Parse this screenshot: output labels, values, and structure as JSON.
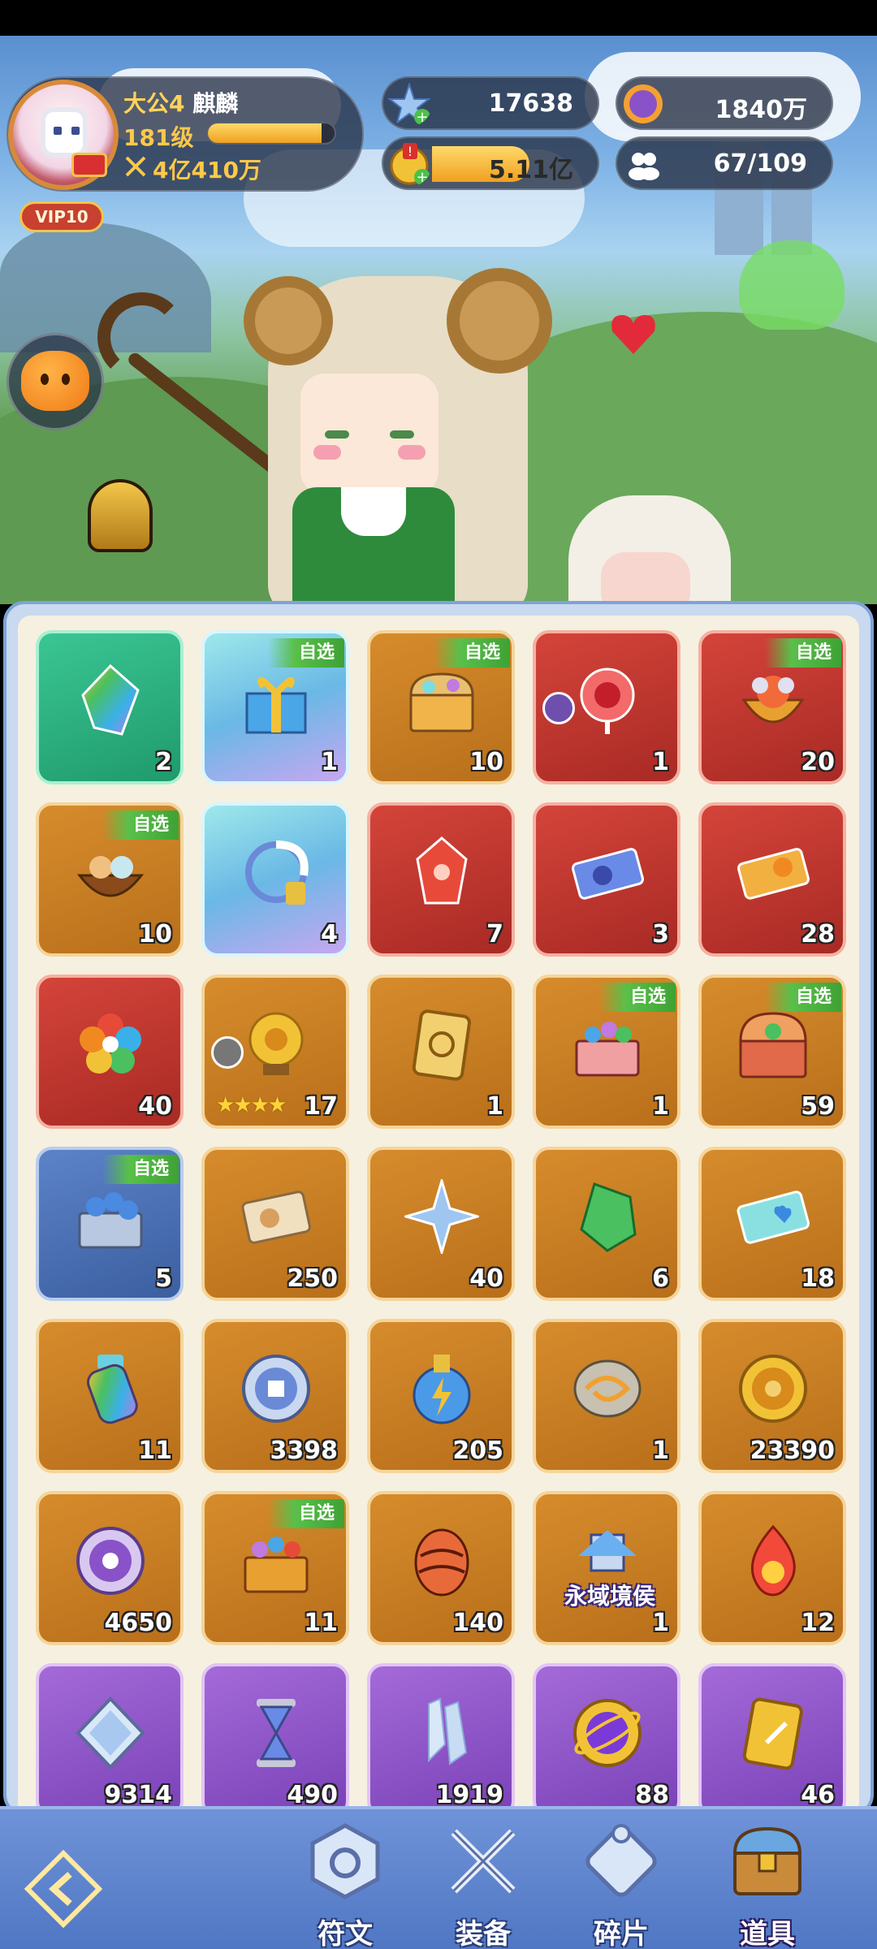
{
  "player": {
    "title": "大公4",
    "name": "麒麟",
    "level": "181级",
    "exp_fraction": 0.9,
    "power": "4亿410万",
    "vip": "VIP10"
  },
  "resources": [
    {
      "name": "star-gem",
      "value": "17638"
    },
    {
      "name": "purple-coin",
      "value": "1840万"
    },
    {
      "name": "gold-coin",
      "value": "5.11亿",
      "bar_fraction": 0.6
    },
    {
      "name": "friends",
      "value": "67/109"
    }
  ],
  "inventory": [
    {
      "icon": "rainbow-crystal-icon",
      "count": "2",
      "color": "green",
      "tag": ""
    },
    {
      "icon": "gift-box-icon",
      "count": "1",
      "color": "cyan",
      "tag": "自选"
    },
    {
      "icon": "treasure-chest-icon",
      "count": "10",
      "color": "orange",
      "tag": "自选"
    },
    {
      "icon": "crystal-ball-icon",
      "count": "1",
      "color": "red",
      "tag": ""
    },
    {
      "icon": "fire-egg-bowl-icon",
      "count": "20",
      "color": "red",
      "tag": "自选"
    },
    {
      "icon": "pet-nest-icon",
      "count": "10",
      "color": "orange",
      "tag": "自选"
    },
    {
      "icon": "wing-frame-icon",
      "count": "4",
      "color": "cyan",
      "tag": ""
    },
    {
      "icon": "red-crystal-icon",
      "count": "7",
      "color": "red",
      "tag": ""
    },
    {
      "icon": "blue-ticket-icon",
      "count": "3",
      "color": "red",
      "tag": ""
    },
    {
      "icon": "gold-ticket-icon",
      "count": "28",
      "color": "red",
      "tag": ""
    },
    {
      "icon": "rainbow-flower-icon",
      "count": "40",
      "color": "red",
      "tag": ""
    },
    {
      "icon": "gold-orb-icon",
      "count": "17",
      "color": "orange",
      "tag": "",
      "stars": "★★★★"
    },
    {
      "icon": "gold-card-icon",
      "count": "1",
      "color": "orange",
      "tag": ""
    },
    {
      "icon": "gem-chest-icon",
      "count": "1",
      "color": "orange",
      "tag": "自选"
    },
    {
      "icon": "big-chest-icon",
      "count": "59",
      "color": "orange",
      "tag": "自选"
    },
    {
      "icon": "silver-chest-icon",
      "count": "5",
      "color": "blue",
      "tag": "自选"
    },
    {
      "icon": "paper-ticket-icon",
      "count": "250",
      "color": "orange",
      "tag": ""
    },
    {
      "icon": "blue-star-crystal-icon",
      "count": "40",
      "color": "orange",
      "tag": ""
    },
    {
      "icon": "green-crystal-icon",
      "count": "6",
      "color": "orange",
      "tag": ""
    },
    {
      "icon": "heart-ticket-icon",
      "count": "18",
      "color": "orange",
      "tag": ""
    },
    {
      "icon": "rainbow-potion-icon",
      "count": "11",
      "color": "orange",
      "tag": ""
    },
    {
      "icon": "silver-coin-icon",
      "count": "3398",
      "color": "orange",
      "tag": ""
    },
    {
      "icon": "lightning-potion-icon",
      "count": "205",
      "color": "orange",
      "tag": ""
    },
    {
      "icon": "swirl-stone-icon",
      "count": "1",
      "color": "orange",
      "tag": ""
    },
    {
      "icon": "gold-coin-icon",
      "count": "23390",
      "color": "orange",
      "tag": ""
    },
    {
      "icon": "purple-coin-icon",
      "count": "4650",
      "color": "orange",
      "tag": ""
    },
    {
      "icon": "gem-basket-icon",
      "count": "11",
      "color": "orange",
      "tag": "自选"
    },
    {
      "icon": "dragon-egg-icon",
      "count": "140",
      "color": "orange",
      "tag": ""
    },
    {
      "icon": "castle-emblem-icon",
      "count": "1",
      "color": "orange",
      "tag": "",
      "emblem": "永域境侯"
    },
    {
      "icon": "fire-orb-icon",
      "count": "12",
      "color": "orange",
      "tag": ""
    },
    {
      "icon": "diamond-icon",
      "count": "9314",
      "color": "purple",
      "tag": ""
    },
    {
      "icon": "hourglass-icon",
      "count": "490",
      "color": "purple",
      "tag": ""
    },
    {
      "icon": "ice-crystal-icon",
      "count": "1919",
      "color": "purple",
      "tag": ""
    },
    {
      "icon": "purple-orb-icon",
      "count": "88",
      "color": "purple",
      "tag": ""
    },
    {
      "icon": "gold-scroll-icon",
      "count": "46",
      "color": "purple",
      "tag": ""
    }
  ],
  "nav": {
    "items": [
      {
        "label": "符文",
        "icon": "rune-icon"
      },
      {
        "label": "装备",
        "icon": "swords-icon"
      },
      {
        "label": "碎片",
        "icon": "puzzle-icon"
      },
      {
        "label": "道具",
        "icon": "chest-icon",
        "active": true
      }
    ]
  },
  "colors": {
    "gold": "#ffc84a",
    "panel": "#2a3246",
    "nav": "#5a80cc"
  }
}
